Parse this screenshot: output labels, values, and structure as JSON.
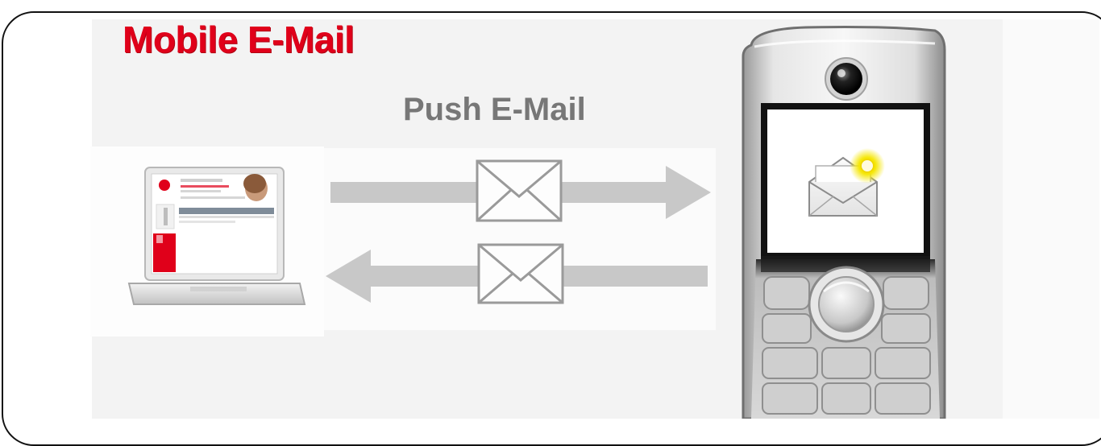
{
  "diagram": {
    "title": "Mobile E-Mail",
    "subtitle": "Push E-Mail"
  },
  "colors": {
    "title": "#e0001a",
    "subtitle": "#777777",
    "arrow": "#c8c8c8",
    "envelope_stroke": "#9a9a9a",
    "notification": "#f5e600"
  },
  "icons": {
    "laptop": "laptop-icon",
    "phone": "mobile-phone-icon",
    "envelope": "envelope-icon",
    "new_mail": "open-envelope-icon"
  }
}
